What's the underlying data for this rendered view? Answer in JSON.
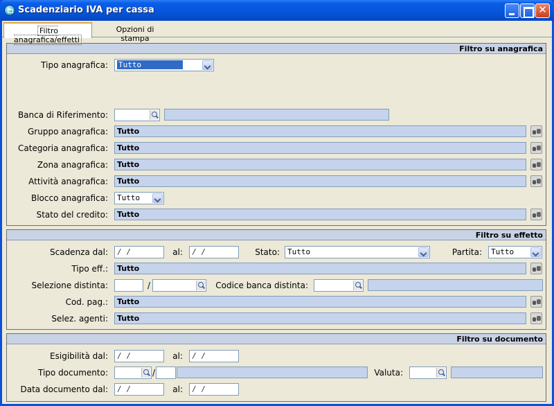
{
  "window": {
    "title": "Scadenziario IVA per cassa"
  },
  "tabs": [
    {
      "label": "Filtro anagrafica/effetti"
    },
    {
      "label": "Opzioni di stampa"
    }
  ],
  "anagrafica": {
    "header": "Filtro su anagrafica",
    "tipo_label": "Tipo anagrafica:",
    "tipo_value": "Tutto",
    "banca_label": "Banca di Riferimento:",
    "gruppo_label": "Gruppo anagrafica:",
    "gruppo_value": "Tutto",
    "categoria_label": "Categoria anagrafica:",
    "categoria_value": "Tutto",
    "zona_label": "Zona anagrafica:",
    "zona_value": "Tutto",
    "attivita_label": "Attività anagrafica:",
    "attivita_value": "Tutto",
    "blocco_label": "Blocco anagrafica:",
    "blocco_value": "Tutto",
    "stato_credito_label": "Stato del credito:",
    "stato_credito_value": "Tutto"
  },
  "effetto": {
    "header": "Filtro su effetto",
    "scadenza_label": "Scadenza dal:",
    "date_placeholder": " /  /",
    "al_label": "al:",
    "stato_label": "Stato:",
    "stato_value": "Tutto",
    "partita_label": "Partita:",
    "partita_value": "Tutto",
    "tipo_eff_label": "Tipo eff.:",
    "tipo_eff_value": "Tutto",
    "distinta_label": "Selezione distinta:",
    "slash": "/",
    "codice_banca_label": "Codice banca distinta:",
    "cod_pag_label": "Cod. pag.:",
    "cod_pag_value": "Tutto",
    "agenti_label": "Selez. agenti:",
    "agenti_value": "Tutto"
  },
  "documento": {
    "header": "Filtro su documento",
    "esigibilita_label": "Esigibilità dal:",
    "date_placeholder": " /  /",
    "al_label": "al:",
    "tipo_doc_label": "Tipo documento:",
    "slash": "/",
    "valuta_label": "Valuta:",
    "data_doc_label": "Data documento dal:"
  }
}
